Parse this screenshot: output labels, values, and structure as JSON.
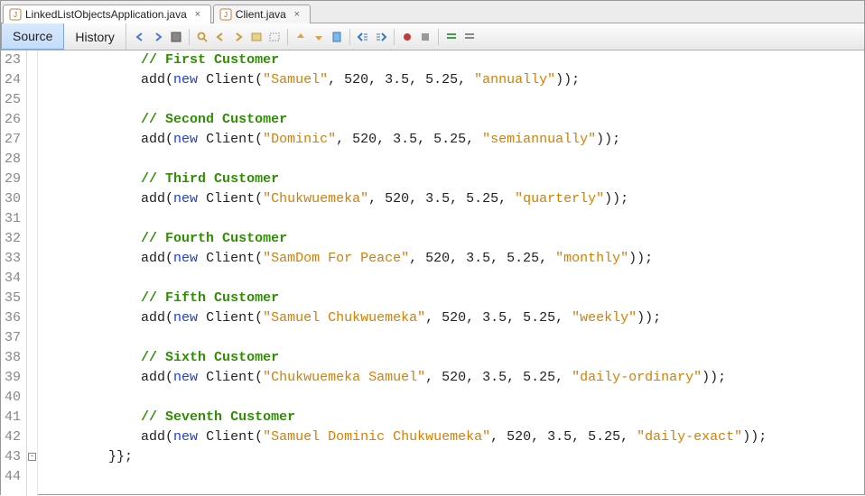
{
  "tabs": [
    {
      "label": "LinkedListObjectsApplication.java",
      "active": true
    },
    {
      "label": "Client.java",
      "active": false
    }
  ],
  "subtabs": {
    "source": "Source",
    "history": "History"
  },
  "gutter_start": 23,
  "gutter_end": 44,
  "code_lines": [
    {
      "indent": 3,
      "type": "comment",
      "text": "// First Customer"
    },
    {
      "indent": 3,
      "type": "call",
      "name_str": "\"Samuel\"",
      "args_rest": ", 520, 3.5, 5.25, ",
      "mode_str": "\"annually\""
    },
    {
      "indent": 0,
      "type": "blank"
    },
    {
      "indent": 3,
      "type": "comment",
      "text": "// Second Customer"
    },
    {
      "indent": 3,
      "type": "call",
      "name_str": "\"Dominic\"",
      "args_rest": ", 520, 3.5, 5.25, ",
      "mode_str": "\"semiannually\""
    },
    {
      "indent": 0,
      "type": "blank"
    },
    {
      "indent": 3,
      "type": "comment",
      "text": "// Third Customer"
    },
    {
      "indent": 3,
      "type": "call",
      "name_str": "\"Chukwuemeka\"",
      "args_rest": ", 520, 3.5, 5.25, ",
      "mode_str": "\"quarterly\""
    },
    {
      "indent": 0,
      "type": "blank"
    },
    {
      "indent": 3,
      "type": "comment",
      "text": "// Fourth Customer"
    },
    {
      "indent": 3,
      "type": "call",
      "name_str": "\"SamDom For Peace\"",
      "args_rest": ", 520, 3.5, 5.25, ",
      "mode_str": "\"monthly\""
    },
    {
      "indent": 0,
      "type": "blank"
    },
    {
      "indent": 3,
      "type": "comment",
      "text": "// Fifth Customer"
    },
    {
      "indent": 3,
      "type": "call",
      "name_str": "\"Samuel Chukwuemeka\"",
      "args_rest": ", 520, 3.5, 5.25, ",
      "mode_str": "\"weekly\""
    },
    {
      "indent": 0,
      "type": "blank"
    },
    {
      "indent": 3,
      "type": "comment",
      "text": "// Sixth Customer"
    },
    {
      "indent": 3,
      "type": "call",
      "name_str": "\"Chukwuemeka Samuel\"",
      "args_rest": ", 520, 3.5, 5.25, ",
      "mode_str": "\"daily-ordinary\""
    },
    {
      "indent": 0,
      "type": "blank"
    },
    {
      "indent": 3,
      "type": "comment",
      "text": "// Seventh Customer"
    },
    {
      "indent": 3,
      "type": "call",
      "name_str": "\"Samuel Dominic Chukwuemeka\"",
      "args_rest": ", 520, 3.5, 5.25, ",
      "mode_str": "\"daily-exact\""
    },
    {
      "indent": 2,
      "type": "plain",
      "text": "}};"
    },
    {
      "indent": 0,
      "type": "blank"
    }
  ],
  "call_tokens": {
    "add": "add(",
    "new": "new",
    "client": " Client(",
    "close": "));"
  },
  "indent_unit": "    "
}
